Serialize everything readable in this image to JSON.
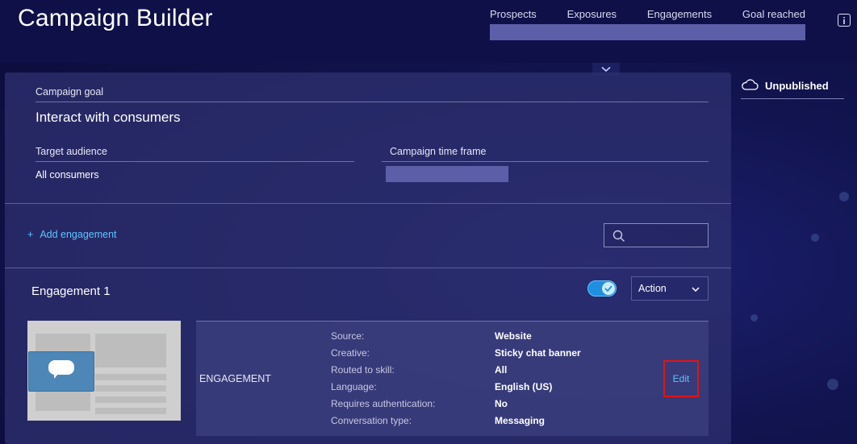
{
  "app": {
    "title": "Campaign Builder"
  },
  "stats": {
    "labels": [
      "Prospects",
      "Exposures",
      "Engagements",
      "Goal reached"
    ]
  },
  "icons": {
    "info": "info-icon",
    "collapse": "chevron-down-icon",
    "cloud": "cloud-icon",
    "search": "search-icon",
    "check": "check-icon",
    "chat": "chat-bubble-icon"
  },
  "campaign": {
    "goal_label": "Campaign goal",
    "goal_value": "Interact with consumers",
    "audience_label": "Target audience",
    "audience_value": "All consumers",
    "timeframe_label": "Campaign time frame",
    "timeframe_value": ""
  },
  "engagements": {
    "add_label": "Add engagement",
    "add_prefix": "+",
    "search_placeholder": "",
    "items": [
      {
        "title": "Engagement 1",
        "enabled": true,
        "action_label": "Action",
        "type_label": "ENGAGEMENT",
        "details": [
          {
            "key": "Source:",
            "value": "Website"
          },
          {
            "key": "Creative:",
            "value": "Sticky chat banner"
          },
          {
            "key": "Routed to skill:",
            "value": "All"
          },
          {
            "key": "Language:",
            "value": "English (US)"
          },
          {
            "key": "Requires authentication:",
            "value": "No"
          },
          {
            "key": "Conversation type:",
            "value": "Messaging"
          }
        ],
        "edit_label": "Edit"
      }
    ]
  },
  "status": {
    "label": "Unpublished"
  },
  "colors": {
    "accent": "#5fc4ff",
    "toggle_on": "#1f8fe0",
    "highlight": "#e01414",
    "background": "#121450"
  }
}
